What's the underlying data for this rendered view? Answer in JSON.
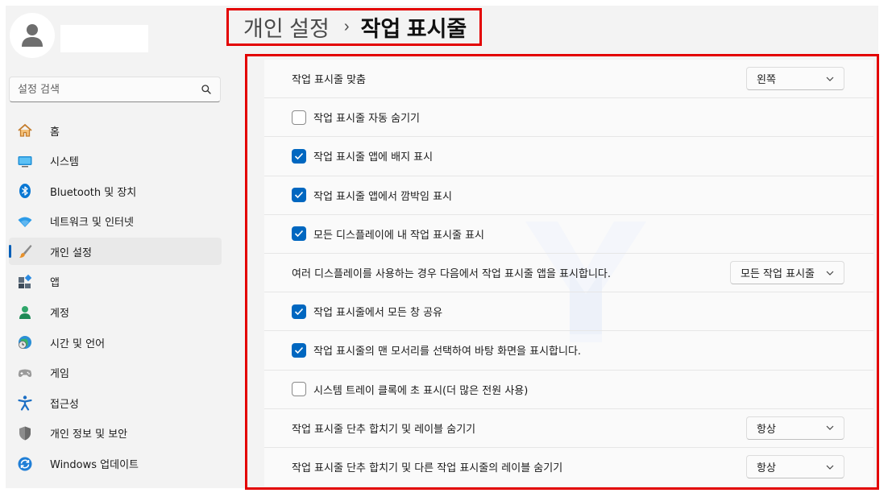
{
  "search": {
    "placeholder": "설정 검색"
  },
  "breadcrumb": {
    "parent": "개인 설정",
    "separator": "›",
    "current": "작업 표시줄"
  },
  "sidebar": {
    "items": [
      {
        "label": "홈",
        "icon": "home-icon"
      },
      {
        "label": "시스템",
        "icon": "system-icon"
      },
      {
        "label": "Bluetooth 및 장치",
        "icon": "bluetooth-icon"
      },
      {
        "label": "네트워크 및 인터넷",
        "icon": "wifi-icon"
      },
      {
        "label": "개인 설정",
        "icon": "brush-icon",
        "active": true
      },
      {
        "label": "앱",
        "icon": "apps-icon"
      },
      {
        "label": "계정",
        "icon": "account-icon"
      },
      {
        "label": "시간 및 언어",
        "icon": "globe-clock-icon"
      },
      {
        "label": "게임",
        "icon": "gamepad-icon"
      },
      {
        "label": "접근성",
        "icon": "accessibility-icon"
      },
      {
        "label": "개인 정보 및 보안",
        "icon": "shield-icon"
      },
      {
        "label": "Windows 업데이트",
        "icon": "update-icon"
      }
    ]
  },
  "settings": {
    "rows": [
      {
        "type": "dropdown",
        "label": "작업 표시줄 맞춤",
        "value": "왼쪽"
      },
      {
        "type": "checkbox",
        "label": "작업 표시줄 자동 숨기기",
        "checked": false
      },
      {
        "type": "checkbox",
        "label": "작업 표시줄 앱에 배지 표시",
        "checked": true
      },
      {
        "type": "checkbox",
        "label": "작업 표시줄 앱에서 깜박임 표시",
        "checked": true
      },
      {
        "type": "checkbox",
        "label": "모든 디스플레이에 내 작업 표시줄 표시",
        "checked": true
      },
      {
        "type": "dropdown",
        "label": "여러 디스플레이를 사용하는 경우 다음에서 작업 표시줄 앱을 표시합니다.",
        "value": "모든 작업 표시줄"
      },
      {
        "type": "checkbox",
        "label": "작업 표시줄에서 모든 창 공유",
        "checked": true
      },
      {
        "type": "checkbox",
        "label": "작업 표시줄의 맨 모서리를 선택하여 바탕 화면을 표시합니다.",
        "checked": true
      },
      {
        "type": "checkbox",
        "label": "시스템 트레이 클록에 초 표시(더 많은 전원 사용)",
        "checked": false
      },
      {
        "type": "dropdown",
        "label": "작업 표시줄 단추 합치기 및 레이블 숨기기",
        "value": "항상"
      },
      {
        "type": "dropdown",
        "label": "작업 표시줄 단추 합치기 및 다른 작업 표시줄의 레이블 숨기기",
        "value": "항상"
      }
    ]
  },
  "colors": {
    "accent": "#0067c0",
    "highlight_border": "#e30000",
    "background": "#f3f3f3"
  }
}
